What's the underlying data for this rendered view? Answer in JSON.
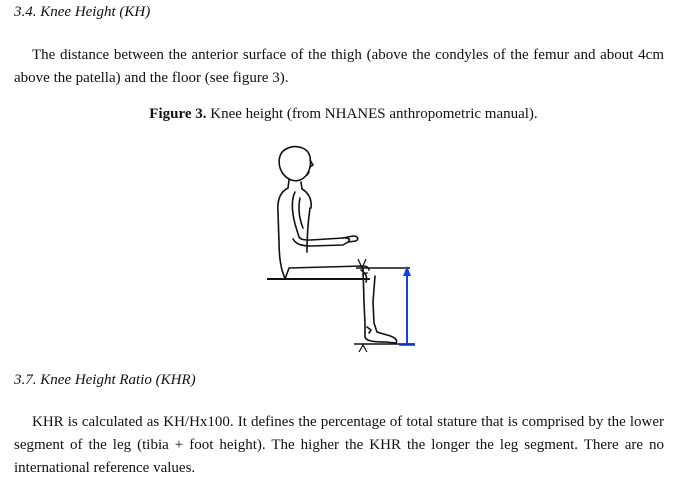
{
  "section_kh": {
    "heading": "3.4. Knee Height (KH)",
    "paragraph": "The distance between the anterior surface of the thigh (above the condyles of the femur and about 4cm above the patella) and the floor (see figure 3)."
  },
  "figure": {
    "label": "Figure 3.",
    "caption": " Knee height (from NHANES anthropometric manual).",
    "arrow_color": "#1a3fd6"
  },
  "section_khr": {
    "heading": "3.7. Knee Height Ratio (KHR)",
    "paragraph": "KHR is calculated as KH/Hx100. It defines the percentage of total stature that is comprised by the lower segment of the leg (tibia + foot height). The higher the KHR the longer the leg segment. There are no international reference values."
  }
}
